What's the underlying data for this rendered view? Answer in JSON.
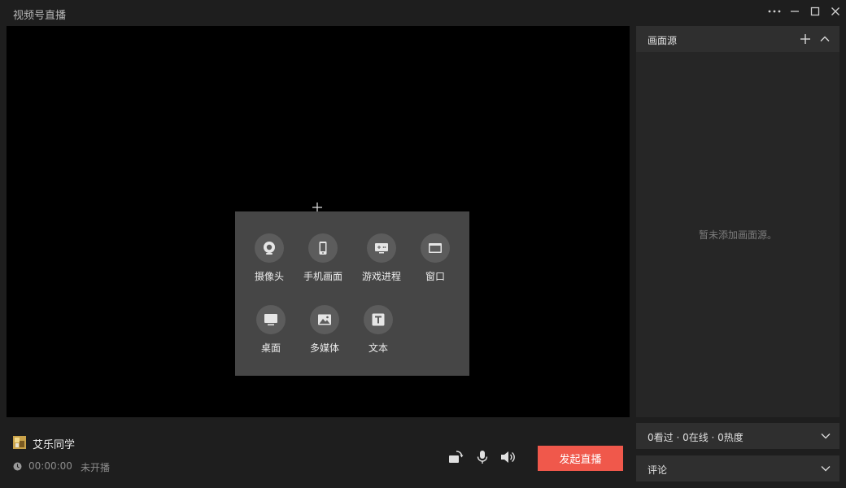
{
  "window": {
    "title": "视频号直播",
    "controls": [
      "more-icon",
      "minimize-icon",
      "maximize-icon",
      "close-icon"
    ]
  },
  "add_source_menu": {
    "items": [
      {
        "label": "摄像头",
        "icon": "webcam-icon"
      },
      {
        "label": "手机画面",
        "icon": "phone-icon"
      },
      {
        "label": "游戏进程",
        "icon": "game-process-icon"
      },
      {
        "label": "窗口",
        "icon": "window-icon"
      },
      {
        "label": "桌面",
        "icon": "desktop-icon"
      },
      {
        "label": "多媒体",
        "icon": "media-icon"
      },
      {
        "label": "文本",
        "icon": "text-icon"
      }
    ]
  },
  "source_panel": {
    "title": "画面源",
    "empty_text": "暂未添加画面源。"
  },
  "stats_row": {
    "text": "0看过 · 0在线 · 0热度"
  },
  "comments_row": {
    "text": "评论"
  },
  "user": {
    "name": "艾乐同学"
  },
  "live": {
    "time": "00:00:00",
    "status": "未开播"
  },
  "start_button": {
    "label": "发起直播"
  },
  "colors": {
    "accent": "#f0584b",
    "preview_bg": "#000000",
    "panel_bg": "#262626"
  }
}
